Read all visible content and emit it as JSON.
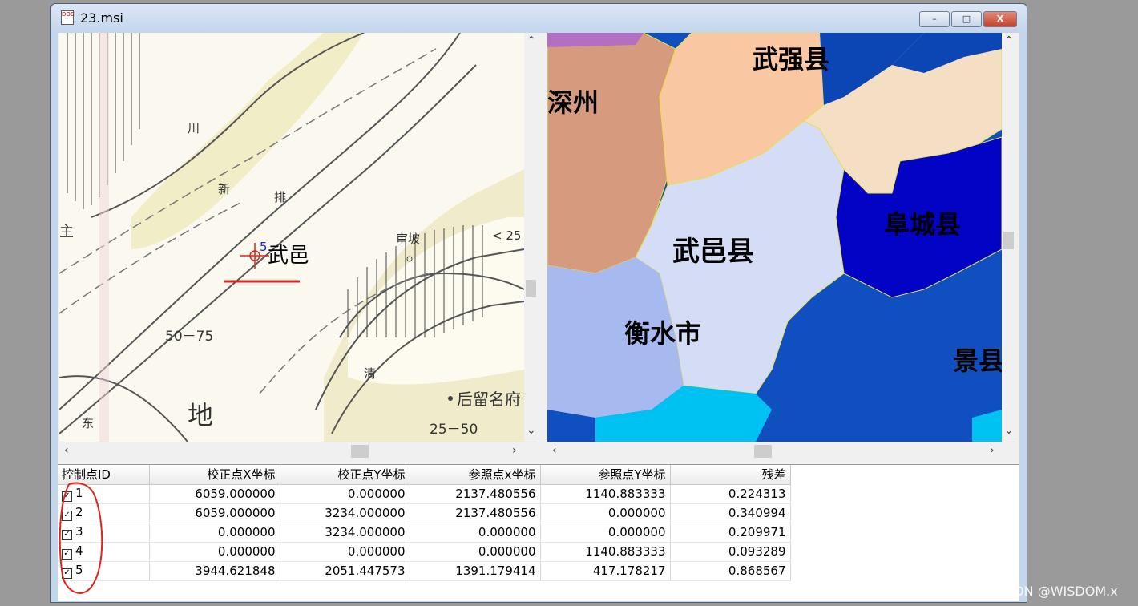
{
  "window": {
    "title": "23.msi",
    "icon": "doc-icon"
  },
  "titlebar_buttons": {
    "minimize": "–",
    "maximize": "□",
    "close": "X"
  },
  "left_map": {
    "labels": [
      "新",
      "排",
      "武邑",
      "审坡",
      "< 25",
      "50－75",
      "清",
      "地",
      "东",
      "后留名府",
      "25－50",
      "主",
      "川"
    ],
    "control_point_label": "5"
  },
  "right_map": {
    "labels": [
      "武强县",
      "深州",
      "武邑县",
      "阜城县",
      "衡水市",
      "景县"
    ]
  },
  "table": {
    "columns": [
      "控制点ID",
      "校正点X坐标",
      "校正点Y坐标",
      "参照点x坐标",
      "参照点Y坐标",
      "残差"
    ],
    "rows": [
      {
        "id": "1",
        "checked": true,
        "cx": "6059.000000",
        "cy": "0.000000",
        "rx": "2137.480556",
        "ry": "1140.883333",
        "res": "0.224313"
      },
      {
        "id": "2",
        "checked": true,
        "cx": "6059.000000",
        "cy": "3234.000000",
        "rx": "2137.480556",
        "ry": "0.000000",
        "res": "0.340994"
      },
      {
        "id": "3",
        "checked": true,
        "cx": "0.000000",
        "cy": "3234.000000",
        "rx": "0.000000",
        "ry": "0.000000",
        "res": "0.209971"
      },
      {
        "id": "4",
        "checked": true,
        "cx": "0.000000",
        "cy": "0.000000",
        "rx": "0.000000",
        "ry": "1140.883333",
        "res": "0.093289"
      },
      {
        "id": "5",
        "checked": true,
        "cx": "3944.621848",
        "cy": "2051.447573",
        "rx": "1391.179414",
        "ry": "417.178217",
        "res": "0.868567"
      }
    ]
  },
  "watermark": "CSDN @WISDOM.x",
  "colors": {
    "annotation_red": "#e0231d",
    "control_point_blue": "#2020e0"
  }
}
